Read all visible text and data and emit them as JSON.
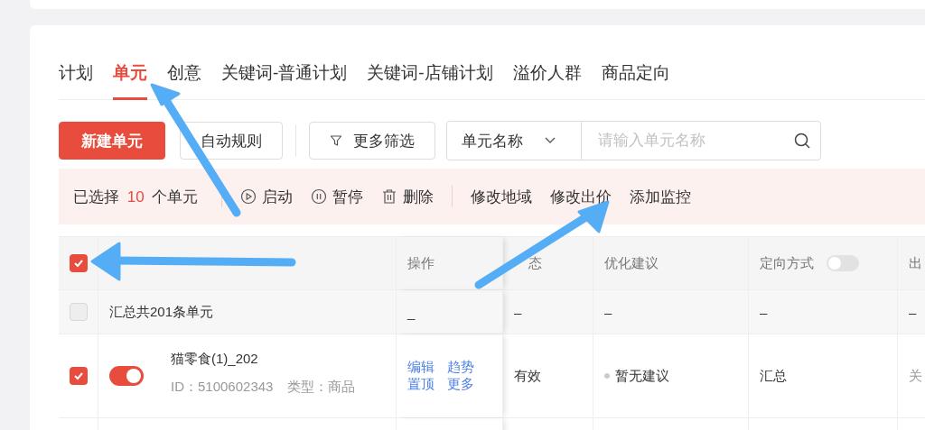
{
  "tabs": [
    {
      "label": "计划",
      "selected": false
    },
    {
      "label": "单元",
      "selected": true
    },
    {
      "label": "创意",
      "selected": false
    },
    {
      "label": "关键词-普通计划",
      "selected": false
    },
    {
      "label": "关键词-店铺计划",
      "selected": false
    },
    {
      "label": "溢价人群",
      "selected": false
    },
    {
      "label": "商品定向",
      "selected": false
    }
  ],
  "toolbar": {
    "new_button": "新建单元",
    "rule_button": "自动规则",
    "filter_button": "更多筛选",
    "search": {
      "field": "单元名称",
      "placeholder": "请输入单元名称"
    }
  },
  "selection_bar": {
    "prefix": "已选择",
    "count": "10",
    "suffix": "个单元",
    "actions": [
      {
        "kind": "play",
        "label": "启动"
      },
      {
        "kind": "pause",
        "label": "暂停"
      },
      {
        "kind": "trash",
        "label": "删除"
      }
    ],
    "edit_actions": [
      "修改地域",
      "修改出价",
      "添加监控"
    ]
  },
  "table": {
    "header_checked": true,
    "columns": [
      {
        "label": "操作"
      },
      {
        "label": "态"
      },
      {
        "label": "优化建议"
      },
      {
        "label": "定向方式",
        "switch_on": false
      },
      {
        "label": "出"
      }
    ],
    "summary": {
      "checked": false,
      "label": "汇总共201条单元",
      "cells": [
        "_",
        "–",
        "–",
        "–",
        "–"
      ]
    },
    "rows": [
      {
        "checked": true,
        "on": true,
        "name": "猫零食(1)_202",
        "id": "ID：5100602343",
        "type": "类型：商品",
        "actions": [
          "编辑",
          "趋势",
          "置顶",
          "更多"
        ],
        "status": "有效",
        "suggestion": "暂无建议",
        "targeting": "汇总",
        "column_7": "关"
      }
    ]
  }
}
